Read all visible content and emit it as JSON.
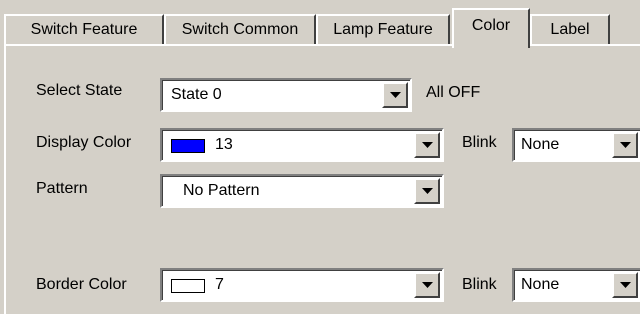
{
  "tabs": [
    {
      "label": "Switch Feature",
      "active": false
    },
    {
      "label": "Switch Common",
      "active": false
    },
    {
      "label": "Lamp Feature",
      "active": false
    },
    {
      "label": "Color",
      "active": true
    },
    {
      "label": "Label",
      "active": false
    }
  ],
  "select_state": {
    "label": "Select State",
    "value": "State 0",
    "note": "All OFF"
  },
  "display_color": {
    "label": "Display Color",
    "value": "13",
    "swatch_color": "#0000ff",
    "blink_label": "Blink",
    "blink_value": "None"
  },
  "pattern": {
    "label": "Pattern",
    "value": "No Pattern"
  },
  "border_color": {
    "label": "Border Color",
    "value": "7",
    "swatch_color": "#ffffff",
    "blink_label": "Blink",
    "blink_value": "None"
  },
  "icons": {
    "dropdown": "chevron-down-icon"
  }
}
